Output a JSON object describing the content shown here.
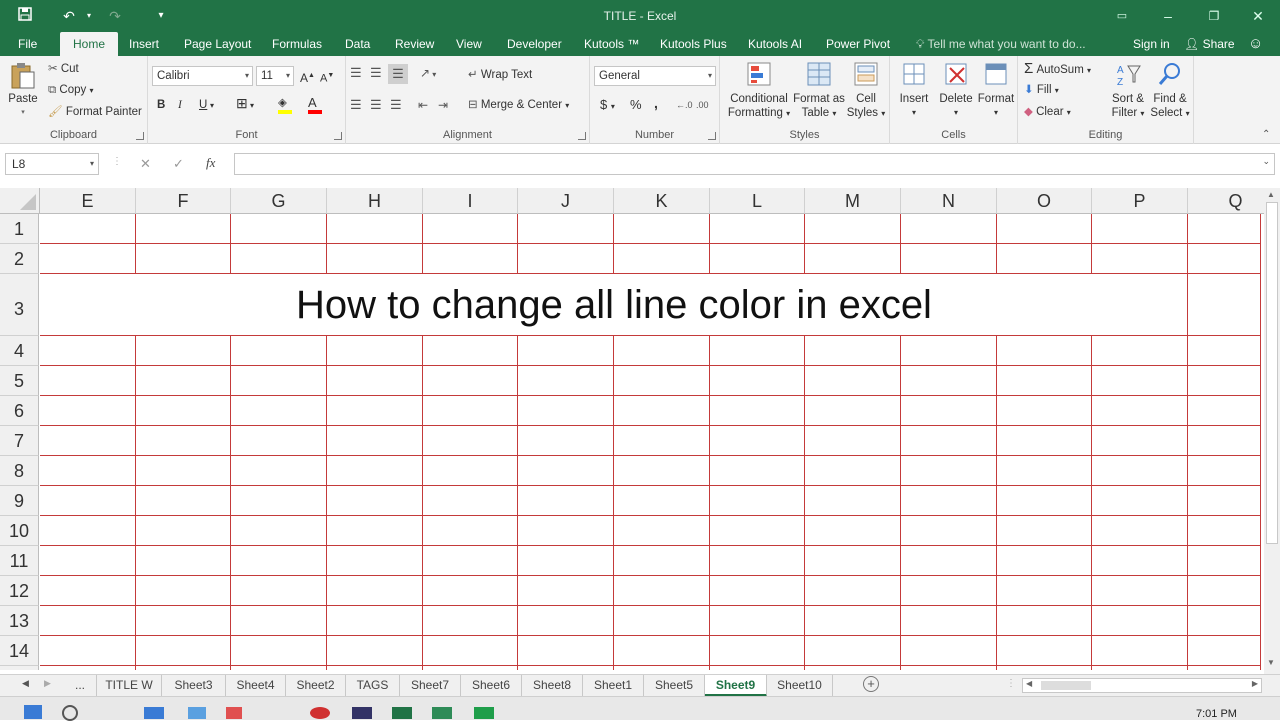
{
  "window": {
    "title": "TITLE - Excel"
  },
  "quick_access": {
    "save_icon": "save-icon",
    "undo_icon": "undo-icon",
    "redo_icon": "redo-icon",
    "customize_icon": "customize-icon"
  },
  "ribbon_tabs": [
    "File",
    "Home",
    "Insert",
    "Page Layout",
    "Formulas",
    "Data",
    "Review",
    "View",
    "Developer",
    "Kutools ™",
    "Kutools Plus",
    "Kutools AI",
    "Power Pivot"
  ],
  "tell_me": "Tell me what you want to do...",
  "sign_in": "Sign in",
  "share": "Share",
  "clipboard": {
    "paste": "Paste",
    "cut": "Cut",
    "copy": "Copy",
    "format_painter": "Format Painter",
    "label": "Clipboard"
  },
  "font": {
    "family": "Calibri",
    "size": "11",
    "bold": "B",
    "italic": "I",
    "underline": "U",
    "label": "Font",
    "fill_color": "#ffff00",
    "font_color": "#ff0000"
  },
  "alignment": {
    "wrap": "Wrap Text",
    "merge": "Merge & Center",
    "label": "Alignment"
  },
  "number": {
    "format": "General",
    "currency": "$",
    "percent": "%",
    "comma": ",",
    "label": "Number"
  },
  "styles": {
    "cond1": "Conditional",
    "cond2": "Formatting",
    "fat1": "Format as",
    "fat2": "Table",
    "cs1": "Cell",
    "cs2": "Styles",
    "label": "Styles"
  },
  "cells": {
    "insert": "Insert",
    "delete": "Delete",
    "format": "Format",
    "label": "Cells"
  },
  "editing": {
    "autosum": "AutoSum",
    "fill": "Fill",
    "clear": "Clear",
    "sort1": "Sort &",
    "sort2": "Filter",
    "find1": "Find &",
    "find2": "Select",
    "label": "Editing"
  },
  "formula_bar": {
    "name_box": "L8",
    "cancel": "✕",
    "enter": "✓",
    "fx": "fx",
    "value": ""
  },
  "grid": {
    "columns": [
      "E",
      "F",
      "G",
      "H",
      "I",
      "J",
      "K",
      "L",
      "M",
      "N",
      "O",
      "P",
      "Q"
    ],
    "rows": [
      "1",
      "2",
      "3",
      "4",
      "5",
      "6",
      "7",
      "8",
      "9",
      "10",
      "11",
      "12",
      "13",
      "14"
    ],
    "merged_text": "How to change all line color in excel",
    "gridline_color": "#c43a3a"
  },
  "sheet_tabs": [
    "...",
    "TITLE W",
    "Sheet3",
    "Sheet4",
    "Sheet2",
    "TAGS",
    "Sheet7",
    "Sheet6",
    "Sheet8",
    "Sheet1",
    "Sheet5",
    "Sheet9",
    "Sheet10"
  ],
  "active_sheet": "Sheet9",
  "status": {
    "time": "7:01 PM"
  },
  "colors": {
    "accent": "#217346"
  }
}
